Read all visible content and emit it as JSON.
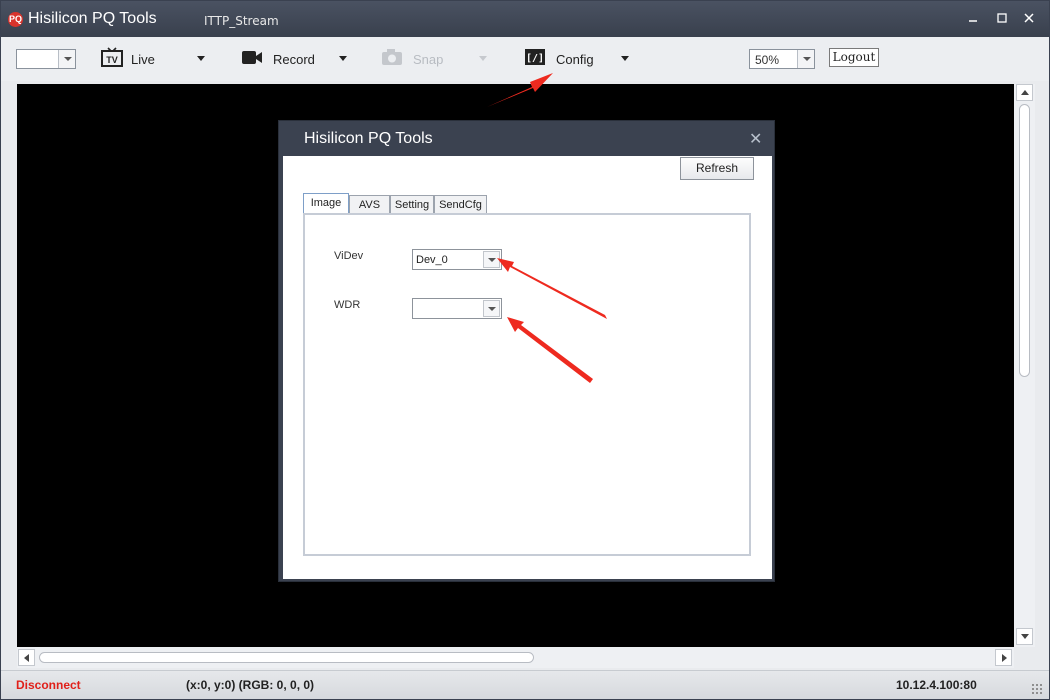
{
  "window": {
    "app_title": "Hisilicon PQ Tools",
    "stream_name": "ITTP_Stream",
    "logo_text": "PQ"
  },
  "toolbar": {
    "channel_combo_value": "",
    "live_label": "Live",
    "record_label": "Record",
    "snap_label": "Snap",
    "config_label": "Config",
    "zoom_value": "50%",
    "logout_label": "Logout"
  },
  "status": {
    "connection": "Disconnect",
    "coords": "(x:0, y:0) (RGB: 0, 0, 0)",
    "ip": "10.12.4.100:80"
  },
  "dialog": {
    "title": "Hisilicon PQ Tools",
    "refresh_label": "Refresh",
    "tabs": [
      "Image",
      "AVS",
      "Setting",
      "SendCfg"
    ],
    "active_tab": "Image",
    "fields": [
      {
        "label": "ViDev",
        "value": "Dev_0"
      },
      {
        "label": "WDR",
        "value": ""
      }
    ]
  },
  "colors": {
    "annotation_arrow": "#ee2a1f",
    "disconnect_text": "#e0201a",
    "titlebar": "#424958"
  }
}
